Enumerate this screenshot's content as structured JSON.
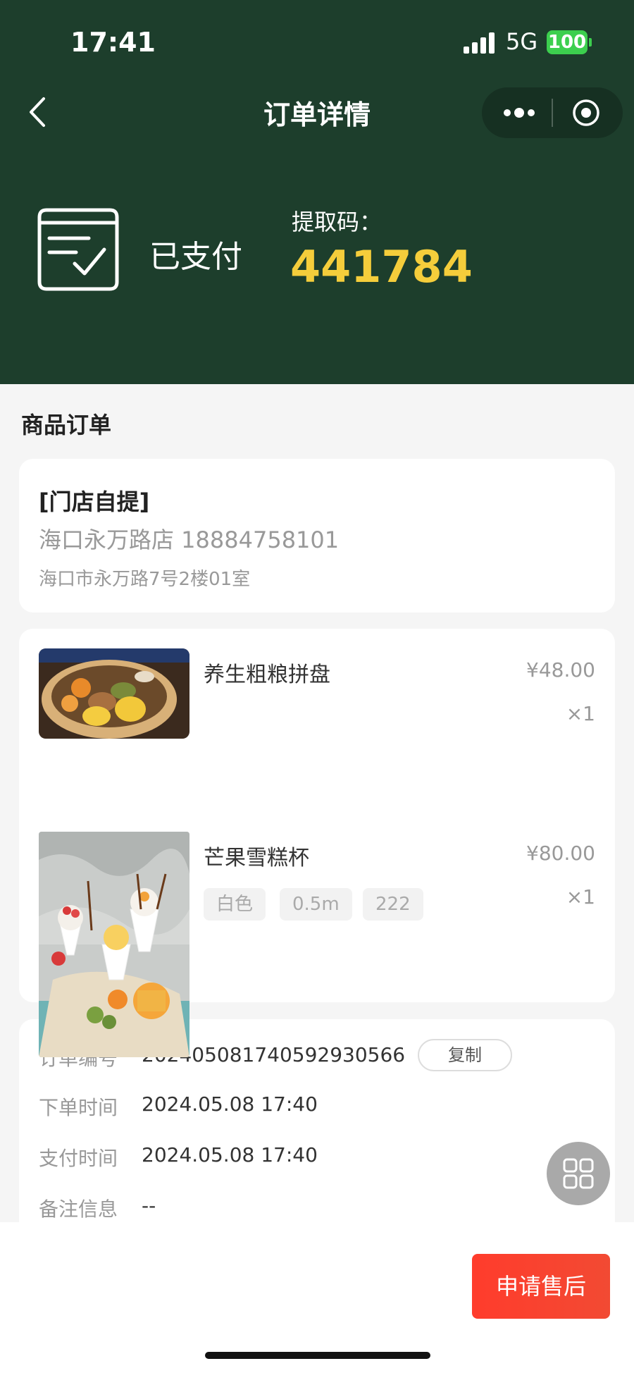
{
  "status_bar": {
    "time": "17:41",
    "network": "5G",
    "battery": "100"
  },
  "nav": {
    "title": "订单详情"
  },
  "order_status": {
    "status": "已支付",
    "pickup_label": "提取码：",
    "pickup_code": "441784"
  },
  "section_title": "商品订单",
  "store": {
    "type": "[门店自提]",
    "name_phone": "海口永万路店 18884758101",
    "address": "海口市永万路7号2楼01室"
  },
  "goods": [
    {
      "name": "养生粗粮拼盘",
      "price": "¥48.00",
      "qty": "×1",
      "tags": []
    },
    {
      "name": "芒果雪糕杯",
      "price": "¥80.00",
      "qty": "×1",
      "tags": [
        "白色",
        "0.5m",
        "222"
      ]
    }
  ],
  "info": {
    "order_no_label": "订单编号",
    "order_no": "202405081740592930566",
    "copy_label": "复制",
    "order_time_label": "下单时间",
    "order_time": "2024.05.08 17:40",
    "pay_time_label": "支付时间",
    "pay_time": "2024.05.08 17:40",
    "remark_label": "备注信息",
    "remark": "--"
  },
  "actions": {
    "apply_after_sale": "申请售后"
  },
  "icons": {
    "back": "back-arrow-icon",
    "more": "more-dots-icon",
    "close": "capsule-close-icon",
    "paid": "paid-box-icon",
    "grid": "grid-menu-icon"
  },
  "colors": {
    "header": "#1d3e2c",
    "code": "#f5cd3b",
    "primary_button": "#ff3c2c"
  }
}
